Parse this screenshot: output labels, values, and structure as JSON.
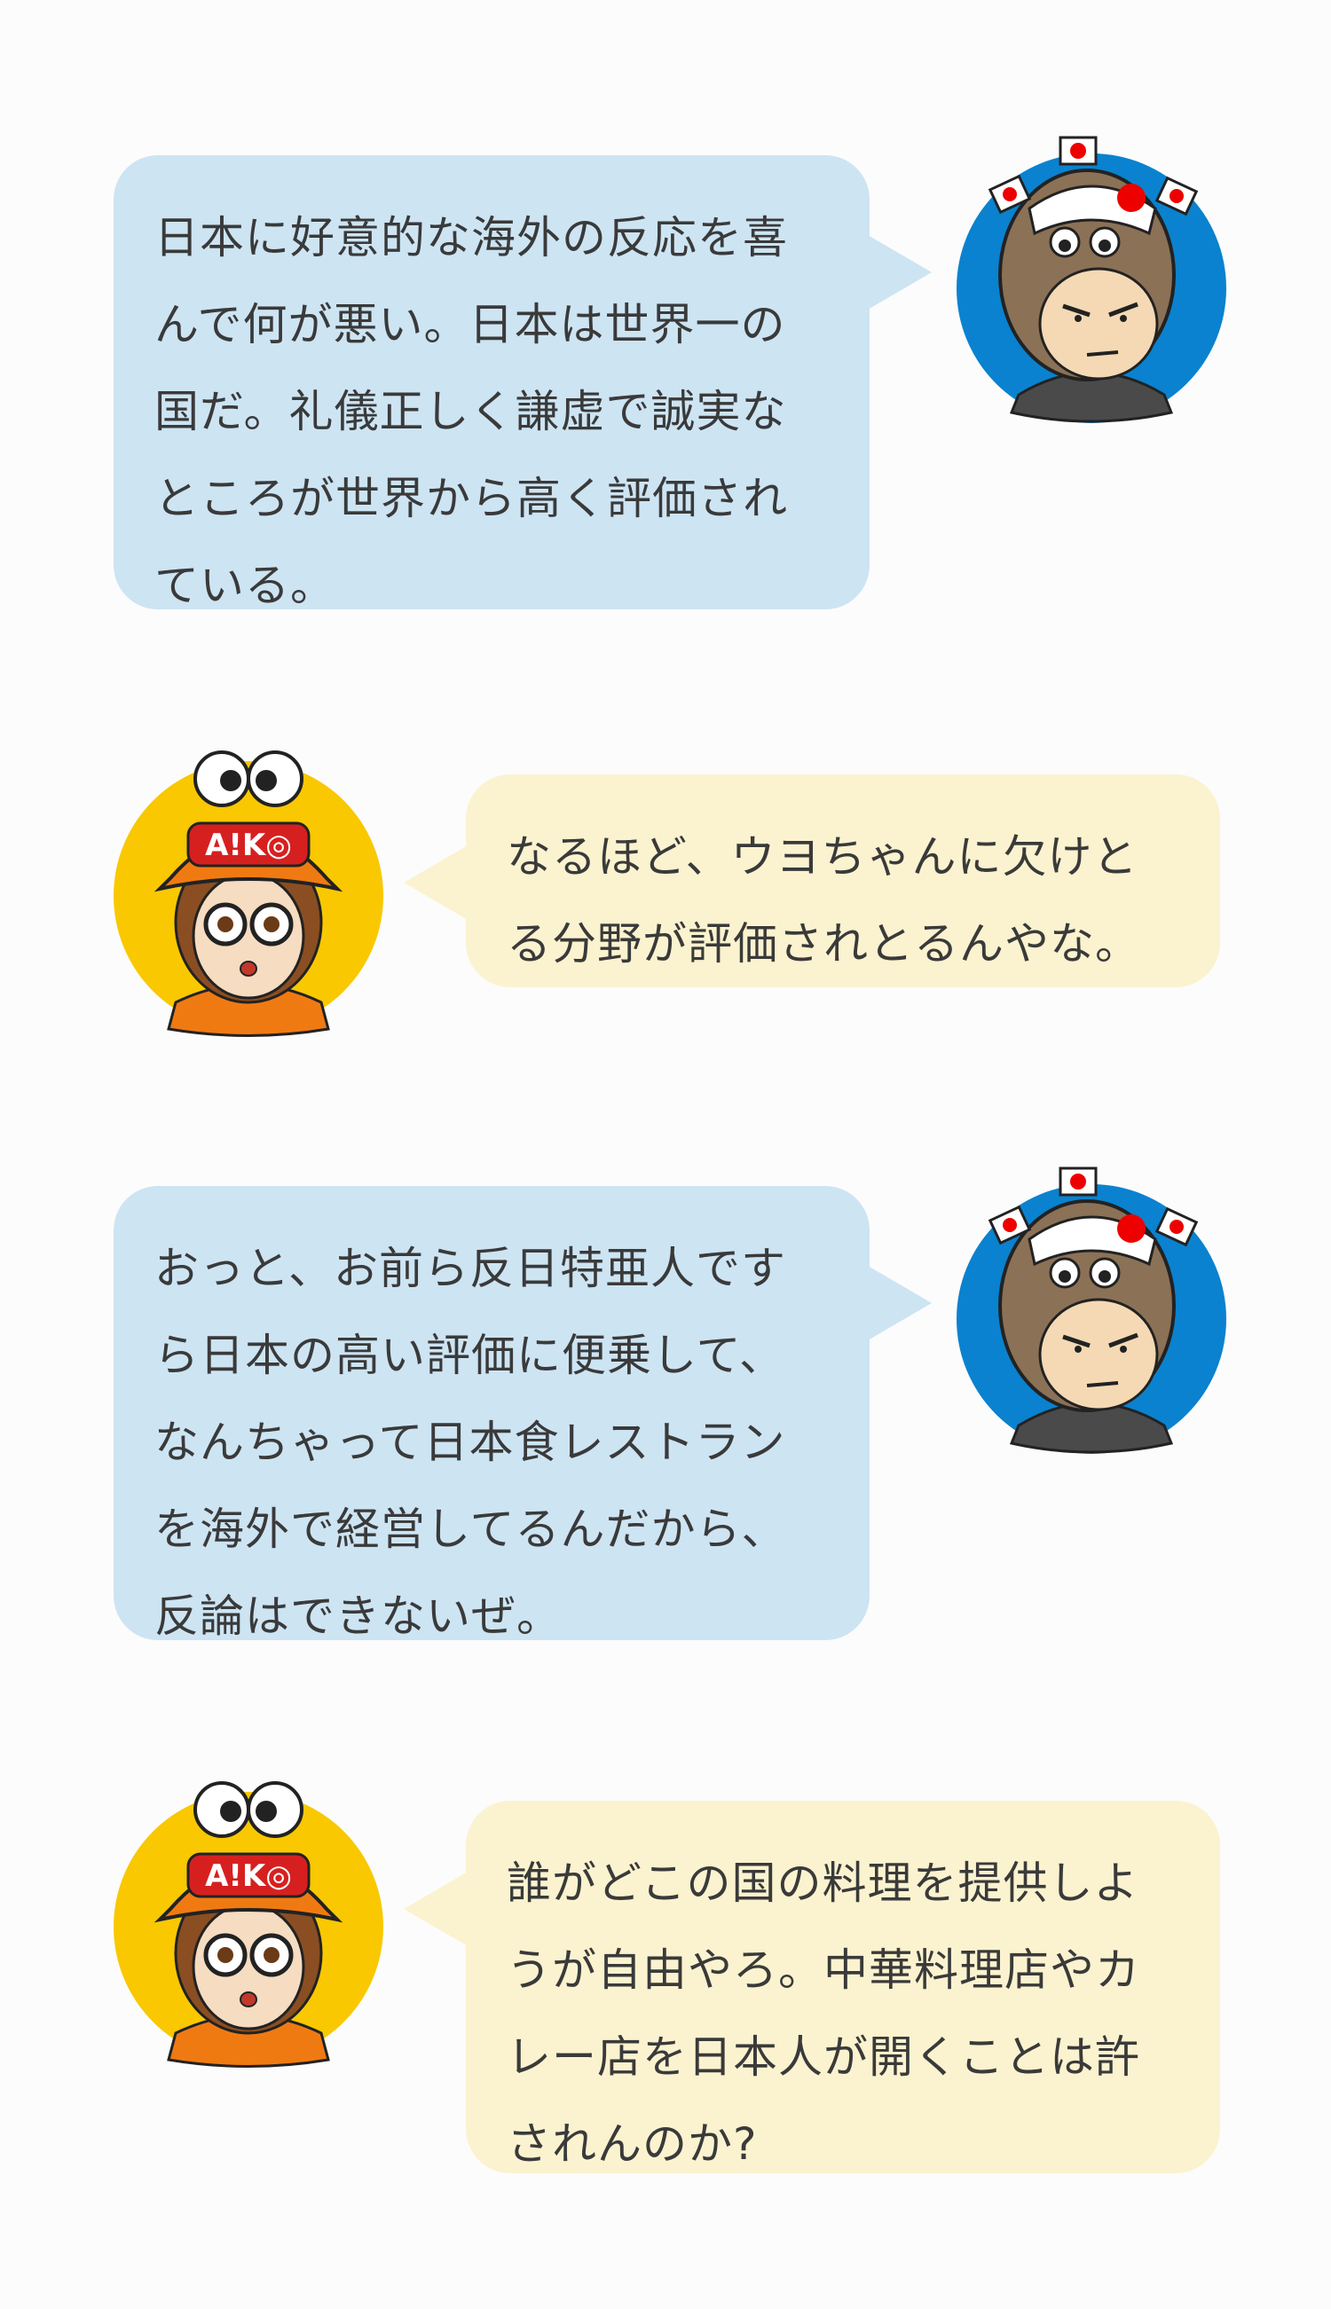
{
  "characters": {
    "uyo": {
      "bg_color": "#0a82cf",
      "icon": "uyo-character-icon"
    },
    "aiko": {
      "bg_color": "#f9c800",
      "icon": "aiko-character-icon",
      "cap_text": "A!K◎"
    }
  },
  "messages": [
    {
      "speaker": "uyo",
      "text": "日本に好意的な海外の反応を喜んで何が悪い。日本は世界一の国だ。礼儀正しく謙虚で誠実なところが世界から高く評価されている。"
    },
    {
      "speaker": "aiko",
      "text": "なるほど、ウヨちゃんに欠けとる分野が評価されとるんやな。"
    },
    {
      "speaker": "uyo",
      "text": "おっと、お前ら反日特亜人ですら日本の高い評価に便乗して、なんちゃって日本食レストランを海外で経営してるんだから、反論はできないぜ。"
    },
    {
      "speaker": "aiko",
      "text": "誰がどこの国の料理を提供しようが自由やろ。中華料理店やカレー店を日本人が開くことは許されんのか?"
    }
  ]
}
